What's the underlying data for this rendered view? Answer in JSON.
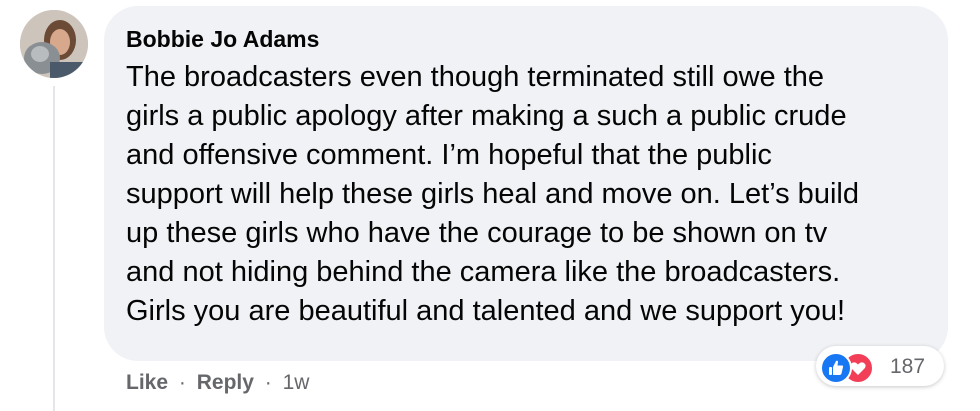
{
  "comment": {
    "author": "Bobbie Jo Adams",
    "lines": [
      "The broadcasters even though terminated still owe the",
      "girls a public apology after making a such a public crude",
      "and offensive comment. I’m hopeful that the public",
      "support will help these girls heal and move on. Let’s build",
      "up these girls who have the courage to be shown on tv",
      "and not hiding behind the camera like the broadcasters.",
      "Girls you are beautiful and talented and we support you!"
    ]
  },
  "actions": {
    "like_label": "Like",
    "separator": "·",
    "reply_label": "Reply",
    "timestamp": "1w"
  },
  "reactions": {
    "count": "187",
    "icons": [
      "like-icon",
      "love-icon"
    ],
    "colors": {
      "like": "#1877f2",
      "love": "#f33e58"
    }
  }
}
